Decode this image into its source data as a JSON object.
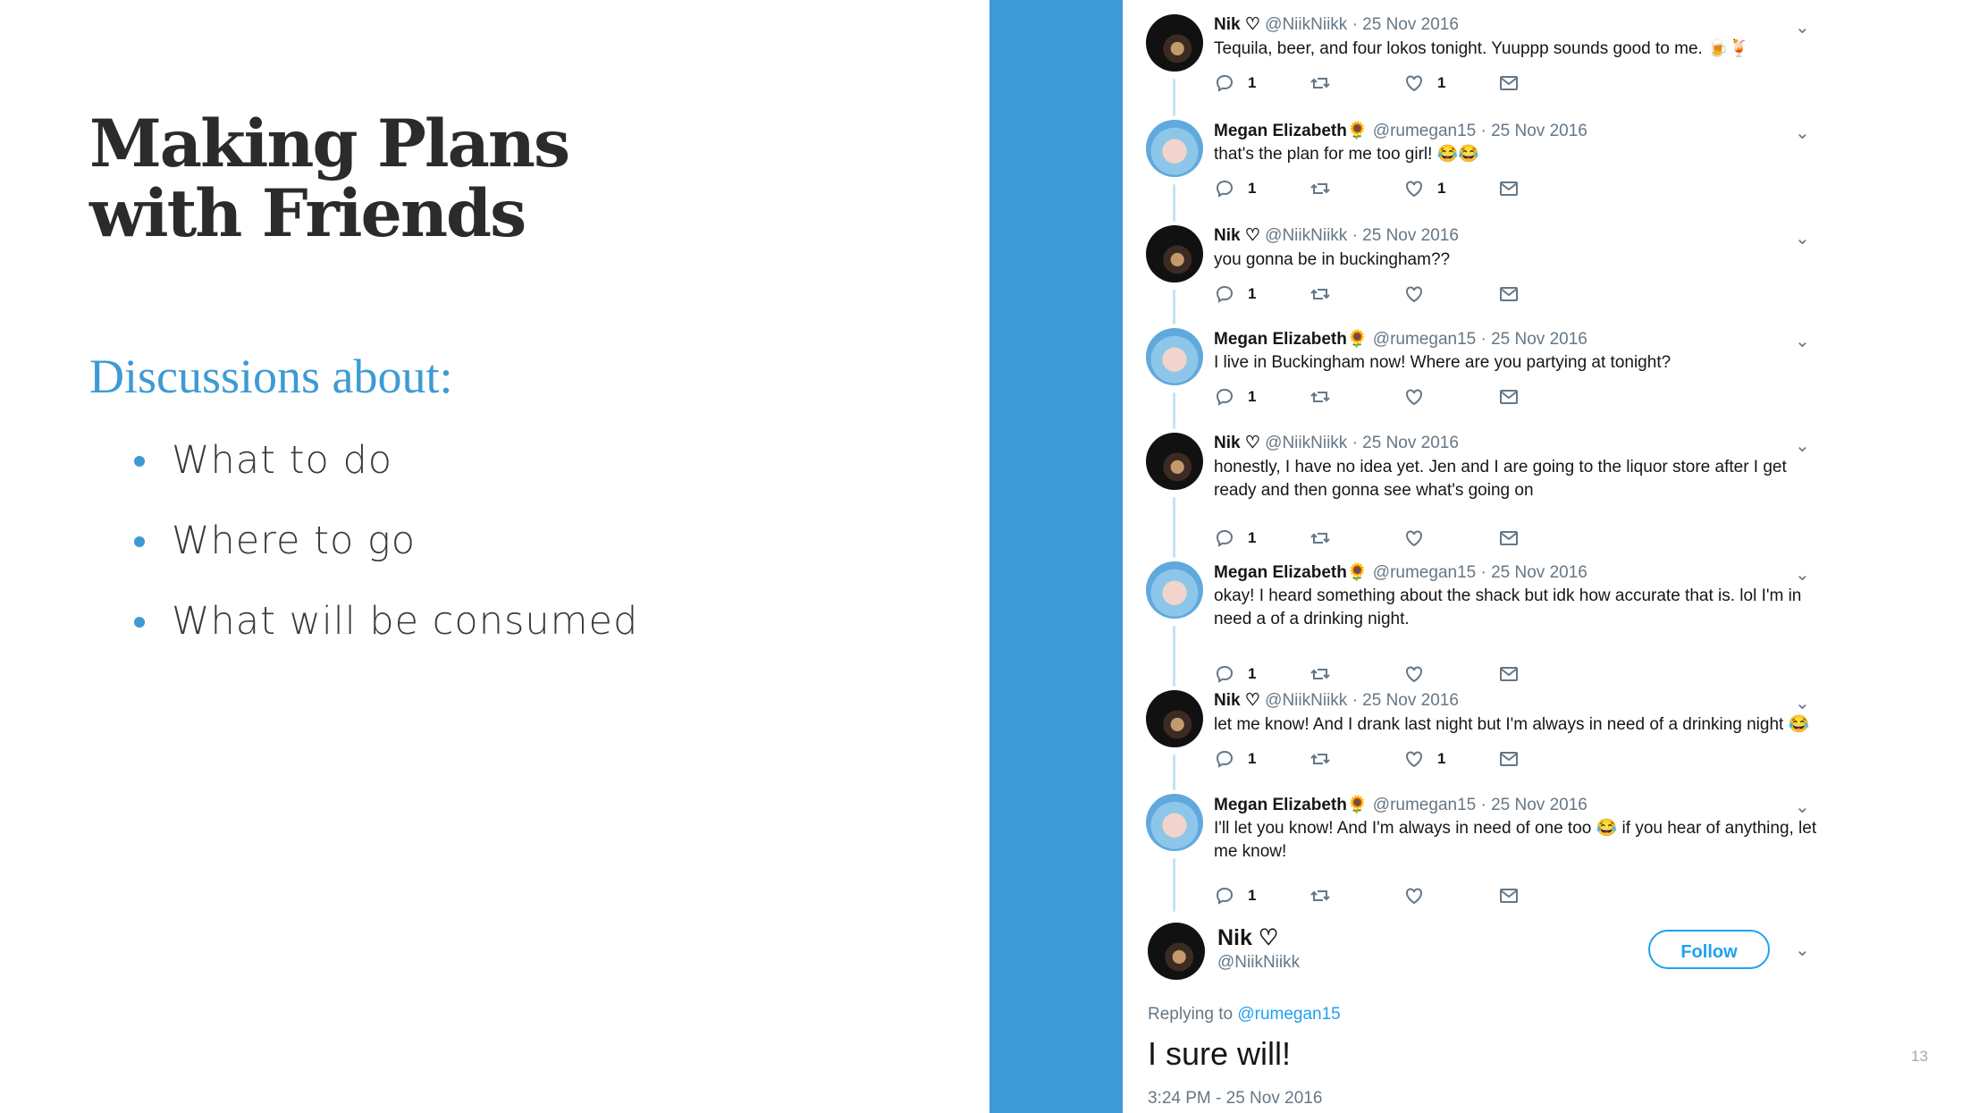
{
  "slide": {
    "title_line1": "Making Plans",
    "title_line2": "with Friends",
    "subtitle": "Discussions about:",
    "bullets": [
      "What to do",
      "Where to go",
      "What will be consumed"
    ],
    "page_number": "13"
  },
  "colors": {
    "accent": "#3d9ad6",
    "twitter_blue": "#1da1f2",
    "muted": "#657786"
  },
  "tweets": [
    {
      "name": "Nik ♡",
      "handle": "@NiikNiikk · 25 Nov 2016",
      "text": "Tequila, beer, and four lokos tonight. Yuuppp sounds good to me. 🍺🍹",
      "replies": "1",
      "retweets": "",
      "likes": "1",
      "avatar": "nik"
    },
    {
      "name": "Megan Elizabeth🌻",
      "handle": "@rumegan15 · 25 Nov 2016",
      "text": "that's the plan for me too girl! 😂😂",
      "replies": "1",
      "retweets": "",
      "likes": "1",
      "avatar": "megan"
    },
    {
      "name": "Nik ♡",
      "handle": "@NiikNiikk · 25 Nov 2016",
      "text": "you gonna be in buckingham??",
      "replies": "1",
      "retweets": "",
      "likes": "",
      "avatar": "nik"
    },
    {
      "name": "Megan Elizabeth🌻",
      "handle": "@rumegan15 · 25 Nov 2016",
      "text": "I live in Buckingham now! Where are you partying at tonight?",
      "replies": "1",
      "retweets": "",
      "likes": "",
      "avatar": "megan"
    },
    {
      "name": "Nik ♡",
      "handle": "@NiikNiikk · 25 Nov 2016",
      "text": "honestly, I have no idea yet. Jen and I are going to the liquor store after I get ready and then gonna see what's going on",
      "replies": "1",
      "retweets": "",
      "likes": "",
      "avatar": "nik"
    },
    {
      "name": "Megan Elizabeth🌻",
      "handle": "@rumegan15 · 25 Nov 2016",
      "text": "okay! I heard something about the shack but idk how accurate that is. lol I'm in need a of a drinking night.",
      "replies": "1",
      "retweets": "",
      "likes": "",
      "avatar": "megan"
    },
    {
      "name": "Nik ♡",
      "handle": "@NiikNiikk · 25 Nov 2016",
      "text": "let me know! And I drank last night but I'm always in need of a drinking night 😂",
      "replies": "1",
      "retweets": "",
      "likes": "1",
      "avatar": "nik"
    },
    {
      "name": "Megan Elizabeth🌻",
      "handle": "@rumegan15 · 25 Nov 2016",
      "text": "I'll let you know! And I'm always in need of one too 😂 if you hear of anything, let me know!",
      "replies": "1",
      "retweets": "",
      "likes": "",
      "avatar": "megan"
    }
  ],
  "main_tweet": {
    "name": "Nik ♡",
    "handle": "@NiikNiikk",
    "follow_label": "Follow",
    "replying_prefix": "Replying to",
    "replying_to": "@rumegan15",
    "text": "I sure will!",
    "timestamp": "3:24 PM - 25 Nov 2016"
  }
}
